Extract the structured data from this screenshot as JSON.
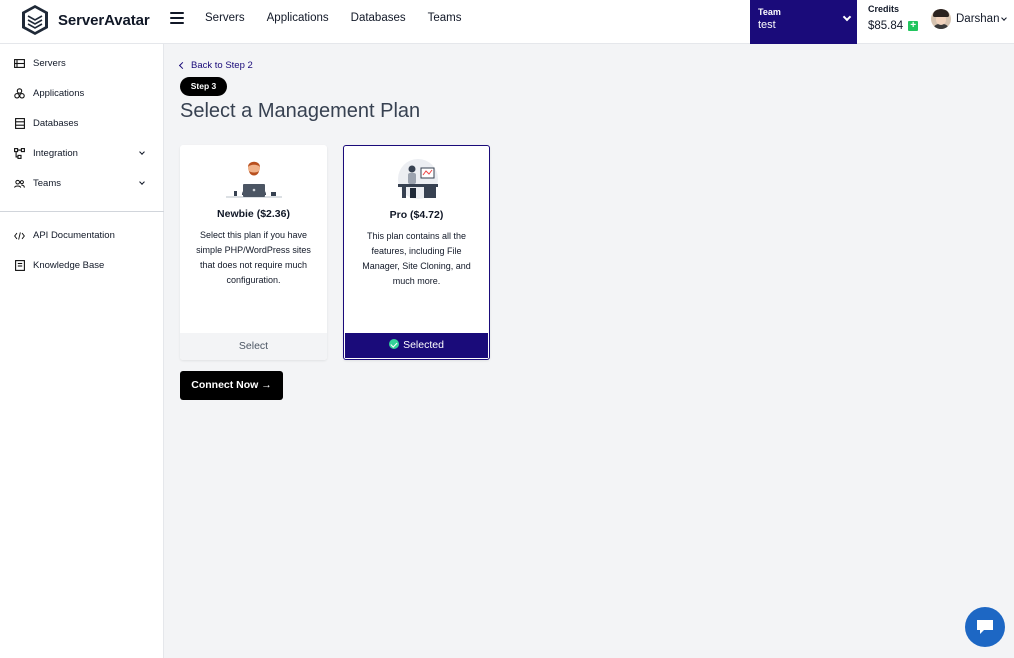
{
  "app": {
    "name": "ServerAvatar"
  },
  "topnav": {
    "items": [
      "Servers",
      "Applications",
      "Databases",
      "Teams"
    ]
  },
  "team": {
    "label": "Team",
    "value": "test"
  },
  "credits": {
    "label": "Credits",
    "value": "$85.84",
    "add_symbol": "+"
  },
  "user": {
    "name": "Darshan"
  },
  "sidebar": {
    "items": [
      {
        "label": "Servers",
        "icon": "server-icon"
      },
      {
        "label": "Applications",
        "icon": "applications-icon"
      },
      {
        "label": "Databases",
        "icon": "database-icon"
      },
      {
        "label": "Integration",
        "icon": "integration-icon",
        "expandable": true
      },
      {
        "label": "Teams",
        "icon": "team-icon",
        "expandable": true
      }
    ],
    "bottom_items": [
      {
        "label": "API Documentation",
        "icon": "code-icon"
      },
      {
        "label": "Knowledge Base",
        "icon": "book-icon"
      }
    ]
  },
  "main": {
    "back_link": "Back to Step 2",
    "step_badge": "Step 3",
    "title": "Select a Management Plan",
    "plans": [
      {
        "title": "Newbie ($2.36)",
        "description": "Select this plan if you have simple PHP/WordPress sites that does not require much configuration.",
        "button": "Select",
        "selected": false
      },
      {
        "title": "Pro ($4.72)",
        "description": "This plan contains all the features, including File Manager, Site Cloning, and much more.",
        "button": "Selected",
        "selected": true
      }
    ],
    "connect_button": "Connect Now →"
  },
  "colors": {
    "brand": "#1a0b7a",
    "accent_green": "#22c55e",
    "chat": "#1d67c4"
  }
}
